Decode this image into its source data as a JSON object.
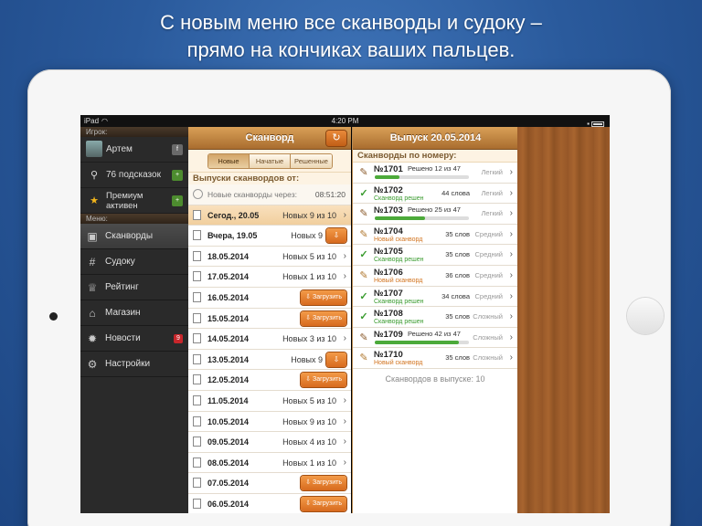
{
  "headline": {
    "line1": "С новым меню все сканворды и судоку –",
    "line2": "прямо на кончиках ваших пальцев."
  },
  "statusbar": {
    "device": "iPad",
    "time": "4:20 PM"
  },
  "sidebar": {
    "player_header": "Игрок:",
    "player": {
      "name": "Артем",
      "hints": "76 подсказок",
      "premium_line1": "Премиум",
      "premium_line2": "активен"
    },
    "menu_header": "Меню:",
    "menu": [
      {
        "label": "Сканворды",
        "icon": "crossword-icon",
        "active": true
      },
      {
        "label": "Судоку",
        "icon": "grid-icon"
      },
      {
        "label": "Рейтинг",
        "icon": "trophy-icon"
      },
      {
        "label": "Магазин",
        "icon": "basket-icon"
      },
      {
        "label": "Новости",
        "icon": "gear-badge-icon",
        "badge": "9"
      },
      {
        "label": "Настройки",
        "icon": "settings-icon"
      }
    ]
  },
  "pane1": {
    "title": "Сканворд",
    "tabs": [
      "Новые",
      "Начатые",
      "Решенные"
    ],
    "section": "Выпуски сканвордов от:",
    "next_label": "Новые сканворды через:",
    "next_time": "08:51:20",
    "download_label": "Загрузить",
    "rows": [
      {
        "date": "Сегод., 20.05",
        "count": "Новых 9 из 10",
        "hl": true
      },
      {
        "date": "Вчера, 19.05",
        "count": "Новых 9",
        "btn": "small"
      },
      {
        "date": "18.05.2014",
        "count": "Новых 5 из 10"
      },
      {
        "date": "17.05.2014",
        "count": "Новых 1 из 10"
      },
      {
        "date": "16.05.2014",
        "btn": "full"
      },
      {
        "date": "15.05.2014",
        "btn": "full"
      },
      {
        "date": "14.05.2014",
        "count": "Новых 3 из 10"
      },
      {
        "date": "13.05.2014",
        "count": "Новых 9",
        "btn": "small"
      },
      {
        "date": "12.05.2014",
        "btn": "full"
      },
      {
        "date": "11.05.2014",
        "count": "Новых 5 из 10"
      },
      {
        "date": "10.05.2014",
        "count": "Новых 9 из 10"
      },
      {
        "date": "09.05.2014",
        "count": "Новых 4 из 10"
      },
      {
        "date": "08.05.2014",
        "count": "Новых 1 из 10"
      },
      {
        "date": "07.05.2014",
        "btn": "full"
      },
      {
        "date": "06.05.2014",
        "btn": "full"
      }
    ]
  },
  "pane2": {
    "title": "Выпуск 20.05.2014",
    "section": "Сканворды по номеру:",
    "footer": "Сканвордов в выпуске: 10",
    "items": [
      {
        "num": "№1701",
        "state": "progress",
        "solved": "Решено 12 из 47",
        "progress": 0.26,
        "level": "Легкий"
      },
      {
        "num": "№1702",
        "state": "done",
        "sub": "Сканворд решен",
        "words": "44 слова",
        "level": "Легкий"
      },
      {
        "num": "№1703",
        "state": "progress",
        "solved": "Решено 25 из 47",
        "progress": 0.53,
        "level": "Легкий"
      },
      {
        "num": "№1704",
        "state": "new",
        "sub": "Новый сканворд",
        "words": "35 слов",
        "level": "Средний"
      },
      {
        "num": "№1705",
        "state": "done",
        "sub": "Сканворд решен",
        "words": "35 слов",
        "level": "Средний"
      },
      {
        "num": "№1706",
        "state": "new",
        "sub": "Новый сканворд",
        "words": "36 слов",
        "level": "Средний"
      },
      {
        "num": "№1707",
        "state": "done",
        "sub": "Сканворд решен",
        "words": "34 слова",
        "level": "Средний"
      },
      {
        "num": "№1708",
        "state": "done",
        "sub": "Сканворд решен",
        "words": "35 слов",
        "level": "Сложный"
      },
      {
        "num": "№1709",
        "state": "progress",
        "solved": "Решено 42 из 47",
        "progress": 0.89,
        "level": "Сложный"
      },
      {
        "num": "№1710",
        "state": "new",
        "sub": "Новый сканворд",
        "words": "35 слов",
        "level": "Сложный"
      }
    ]
  }
}
